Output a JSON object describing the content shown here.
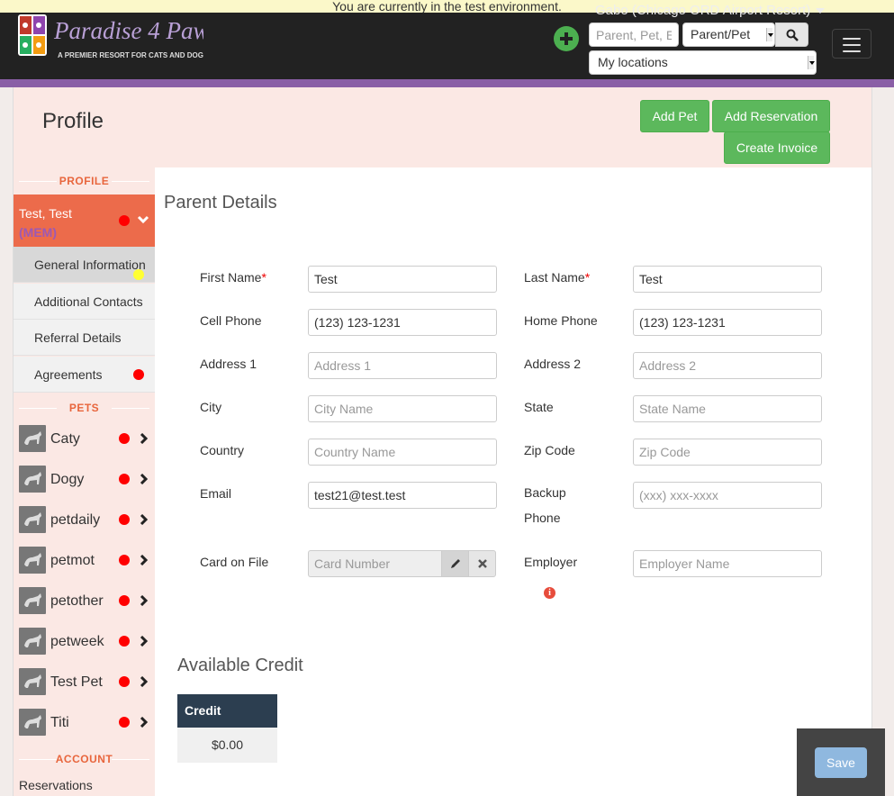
{
  "env_banner": "You are currently in the test environment.",
  "brand": {
    "name": "Paradise 4 Paws",
    "tagline": "A PREMIER RESORT FOR CATS AND DOGS"
  },
  "topbar": {
    "location_title": "Gabo (Chicago ORD Airport Resort)",
    "search_placeholder": "Parent, Pet, E",
    "search_type": "Parent/Pet",
    "location_select": "My locations"
  },
  "header": {
    "title": "Profile",
    "add_pet": "Add Pet",
    "add_reservation": "Add Reservation",
    "create_invoice": "Create Invoice"
  },
  "sidebar": {
    "profile_heading": "PROFILE",
    "parent_name": "Test, Test",
    "parent_tag": "(MEM)",
    "sub_items": [
      {
        "label": "General Information"
      },
      {
        "label": "Additional Contacts"
      },
      {
        "label": "Referral Details"
      },
      {
        "label": "Agreements"
      }
    ],
    "pets_heading": "PETS",
    "pets": [
      {
        "name": "Caty"
      },
      {
        "name": "Dogy"
      },
      {
        "name": "petdaily"
      },
      {
        "name": "petmot"
      },
      {
        "name": "petother"
      },
      {
        "name": "petweek"
      },
      {
        "name": "Test Pet"
      },
      {
        "name": "Titi"
      }
    ],
    "account_heading": "ACCOUNT",
    "account_link": "Reservations"
  },
  "form": {
    "title": "Parent Details",
    "first_name": {
      "label": "First Name",
      "value": "Test"
    },
    "last_name": {
      "label": "Last Name",
      "value": "Test"
    },
    "cell_phone": {
      "label": "Cell Phone",
      "value": "(123) 123-1231"
    },
    "home_phone": {
      "label": "Home Phone",
      "value": "(123) 123-1231"
    },
    "address1": {
      "label": "Address 1",
      "placeholder": "Address 1"
    },
    "address2": {
      "label": "Address 2",
      "placeholder": "Address 2"
    },
    "city": {
      "label": "City",
      "placeholder": "City Name"
    },
    "state": {
      "label": "State",
      "placeholder": "State Name"
    },
    "country": {
      "label": "Country",
      "placeholder": "Country Name"
    },
    "zip": {
      "label": "Zip Code",
      "placeholder": "Zip Code"
    },
    "email": {
      "label": "Email",
      "value": "test21@test.test"
    },
    "backup_phone": {
      "label_line1": "Backup",
      "label_line2": "Phone",
      "placeholder": "(xxx) xxx-xxxx"
    },
    "card": {
      "label": "Card on File",
      "placeholder": "Card Number"
    },
    "employer": {
      "label": "Employer",
      "placeholder": "Employer Name"
    },
    "required_mark": "*"
  },
  "credit": {
    "title": "Available Credit",
    "header": "Credit",
    "value": "$0.00"
  },
  "save_label": "Save",
  "colors": {
    "accent_green": "#5cb85c",
    "sidebar_active": "#ec6b4b",
    "purple": "#8a5fa6",
    "status_red": "#ff0000"
  }
}
